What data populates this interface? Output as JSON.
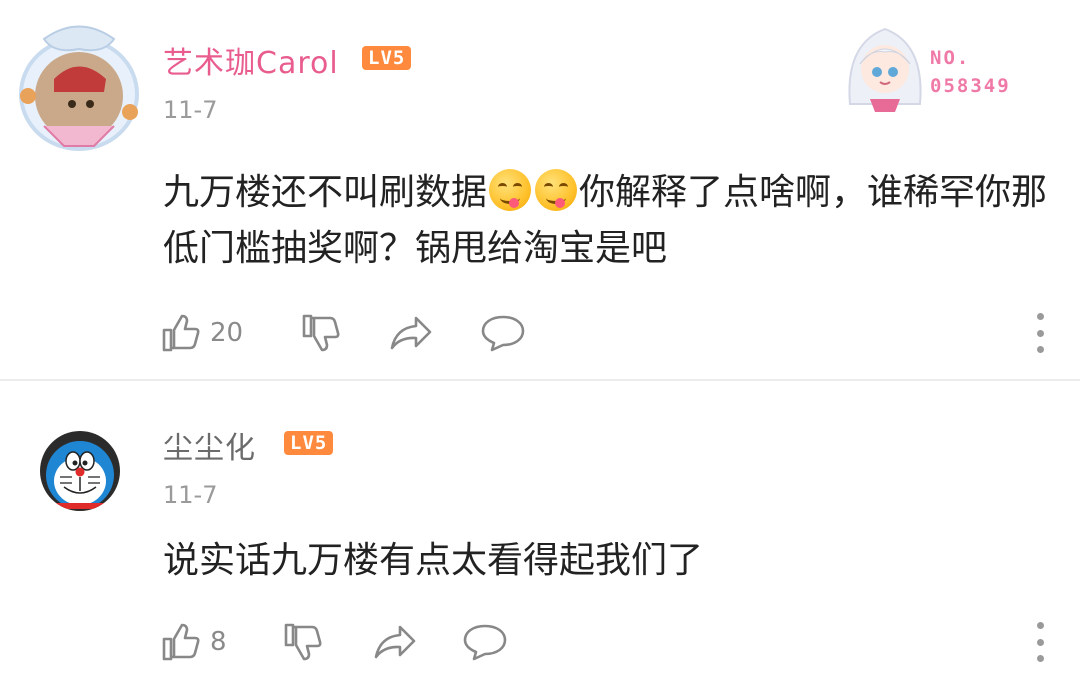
{
  "comments": [
    {
      "username": "艺术珈Carol",
      "level": "LV5",
      "date": "11-7",
      "text_before": "九万楼还不叫刷数据",
      "text_after": "你解释了点啥啊，谁稀罕你那低门槛抽奖啊？锅甩给淘宝是吧",
      "emoji": "yum-face-emoji",
      "like_count": "20",
      "badge": {
        "prefix": "NO.",
        "number": "058349"
      }
    },
    {
      "username": "尘尘化",
      "level": "LV5",
      "date": "11-7",
      "text": "说实话九万楼有点太看得起我们了",
      "like_count": "8"
    }
  ],
  "colors": {
    "username_vip": "#e85d8e",
    "username_normal": "#6b6b6b",
    "level_badge": "#ff8a3d",
    "secondary_text": "#9a9a9a"
  },
  "icons": [
    "thumbs-up-icon",
    "thumbs-down-icon",
    "share-icon",
    "comment-icon",
    "more-vertical-icon"
  ]
}
